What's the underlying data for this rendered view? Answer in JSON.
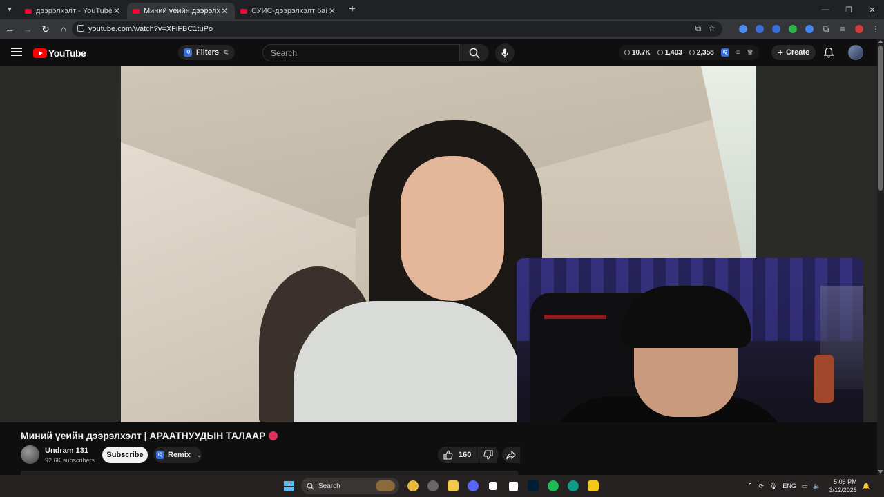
{
  "browser": {
    "tabs": [
      {
        "title": "дээрэлхэлт - YouTube",
        "active": false
      },
      {
        "title": "Миний үеийн дээрэлхэлт | АРА",
        "active": true
      },
      {
        "title": "СУИС-дээрэлхэлт байх ёстой",
        "active": false
      }
    ],
    "close_glyph": "✕",
    "new_tab_glyph": "+",
    "url": "youtube.com/watch?v=XFiFBC1tuPo",
    "window_controls": {
      "minimize": "—",
      "maximize": "❐",
      "close": "✕"
    },
    "extension_colors": [
      "#4a8df0",
      "#3b6fd8",
      "#3b6fd8",
      "#2eb34a",
      "#4285f4",
      "#c4c7c5"
    ]
  },
  "youtube": {
    "logo_text": "YouTube",
    "filters_label": "Filters",
    "filters_badge": "iQ",
    "search_placeholder": "Search",
    "stats": [
      {
        "icon": "clock-icon",
        "value": "10.7K"
      },
      {
        "icon": "eye-icon",
        "value": "1,403"
      },
      {
        "icon": "eye-icon",
        "value": "2,358"
      }
    ],
    "create_label": "Create",
    "accent": "#ff0000"
  },
  "video": {
    "title": "Миний үеийн дээрэлхэлт | АРААТНУУДЫН ТАЛААР",
    "channel_name": "Undram 131",
    "subscribers": "92.6K subscribers",
    "subscribe_label": "Subscribe",
    "remix_label": "Remix",
    "remix_badge": "iQ",
    "likes": "160"
  },
  "taskbar": {
    "search_label": "Search",
    "language": "ENG",
    "time": "5:06 PM",
    "date": "3/12/2026",
    "app_colors": [
      "#e9b63a",
      "#666666",
      "#f2c94c",
      "#5865f2",
      "#ffffff",
      "#ffffff",
      "#001e36",
      "#1db954",
      "#0f9d8a",
      "#f5c518"
    ]
  }
}
